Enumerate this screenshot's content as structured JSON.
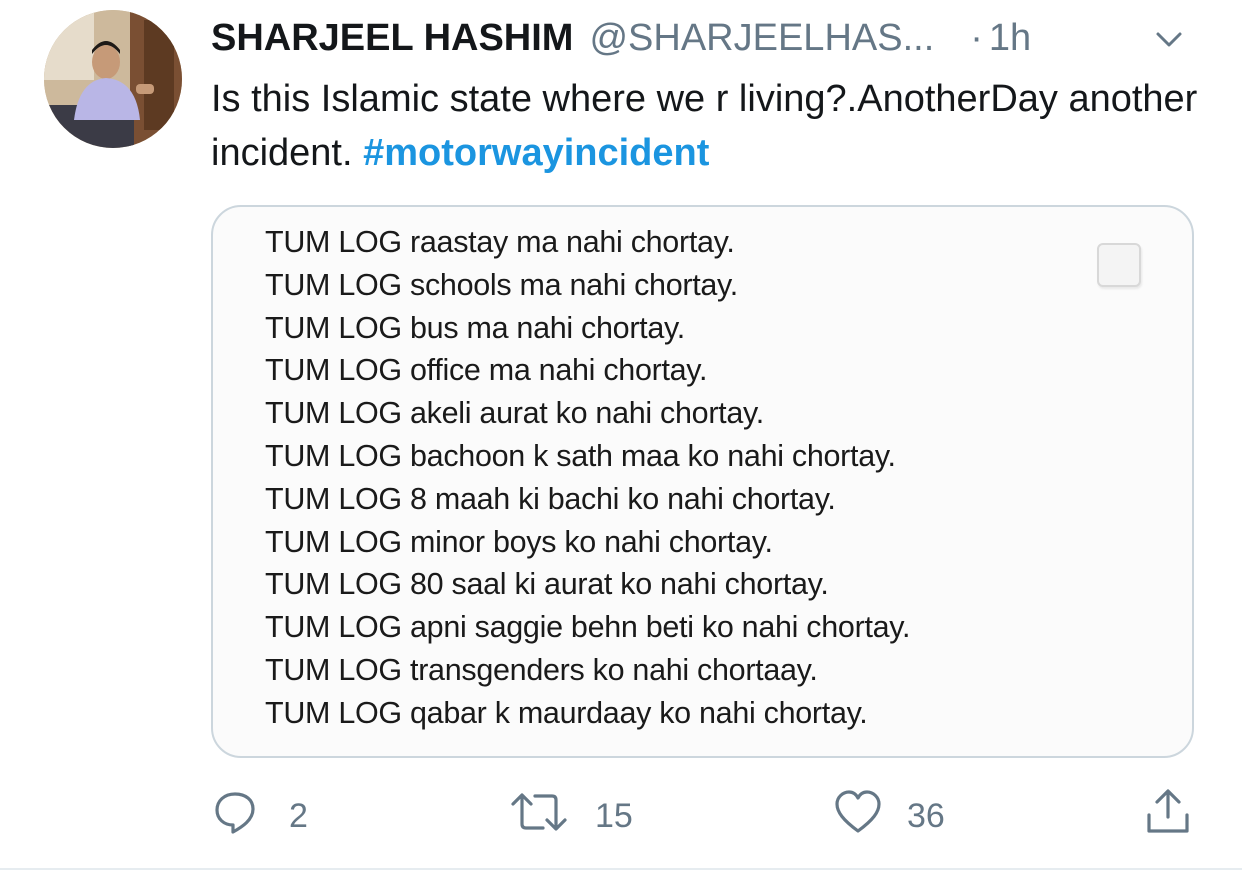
{
  "tweet": {
    "author_name": "SHARJEEL HASHIM",
    "handle": "@SHARJEELHAS...",
    "separator": "·",
    "time": "1h",
    "text": "Is this Islamic state where we r living?.AnotherDay another incident.",
    "hashtag": "#motorwayincident",
    "media_lines": [
      "TUM LOG raastay ma nahi chortay.",
      "TUM LOG schools ma nahi chortay.",
      "TUM LOG bus ma nahi chortay.",
      "TUM LOG office ma nahi chortay.",
      "TUM LOG akeli aurat ko nahi chortay.",
      "TUM LOG bachoon k sath maa ko nahi chortay.",
      "TUM LOG 8 maah ki bachi ko nahi chortay.",
      "TUM LOG minor boys ko nahi chortay.",
      "TUM LOG 80 saal ki aurat ko nahi chortay.",
      "TUM LOG apni saggie behn beti ko nahi chortay.",
      "TUM LOG transgenders ko nahi chortaay.",
      "TUM LOG qabar k maurdaay ko nahi chortay."
    ],
    "actions": {
      "reply_count": "2",
      "retweet_count": "15",
      "like_count": "36"
    }
  },
  "icons": {
    "reply": "reply-icon",
    "retweet": "retweet-icon",
    "like": "heart-icon",
    "share": "share-icon",
    "menu": "chevron-down-icon"
  },
  "colors": {
    "hashtag": "#1b95e0",
    "secondary_text": "#657786",
    "border": "#ccd6dd"
  }
}
